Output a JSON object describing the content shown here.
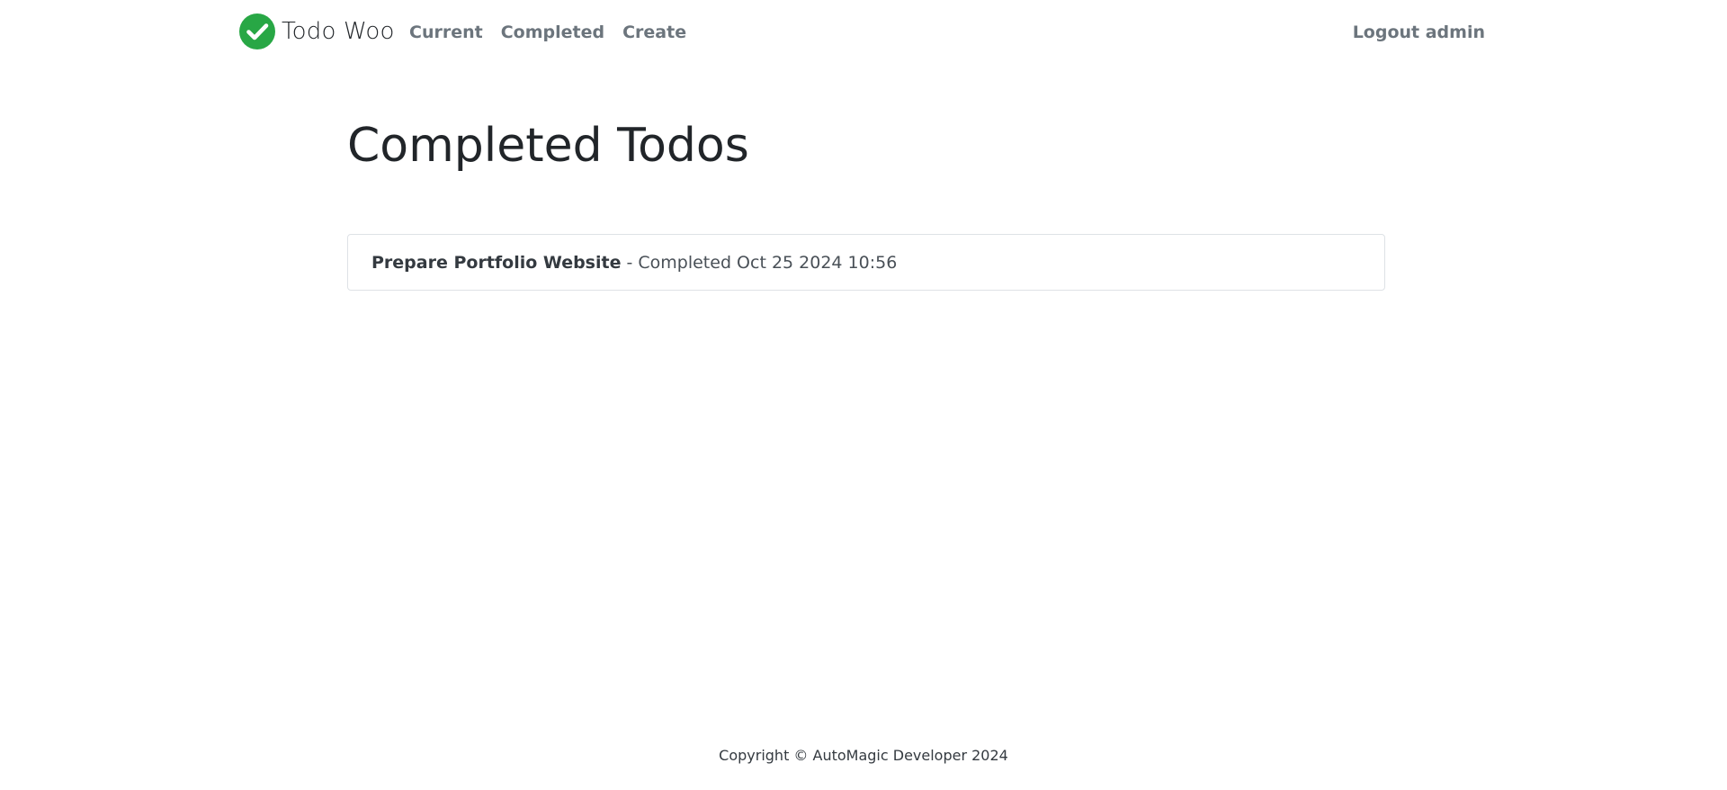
{
  "brand": {
    "name": "Todo Woo",
    "icon": "check-circle-icon",
    "icon_color": "#28a745"
  },
  "nav": {
    "links": [
      {
        "label": "Current"
      },
      {
        "label": "Completed"
      },
      {
        "label": "Create"
      }
    ],
    "logout_label": "Logout admin"
  },
  "main": {
    "title": "Completed Todos",
    "todos": [
      {
        "title": "Prepare Portfolio Website",
        "meta": "- Completed Oct 25 2024 10:56"
      }
    ]
  },
  "footer": {
    "text": "Copyright © AutoMagic Developer 2024"
  }
}
